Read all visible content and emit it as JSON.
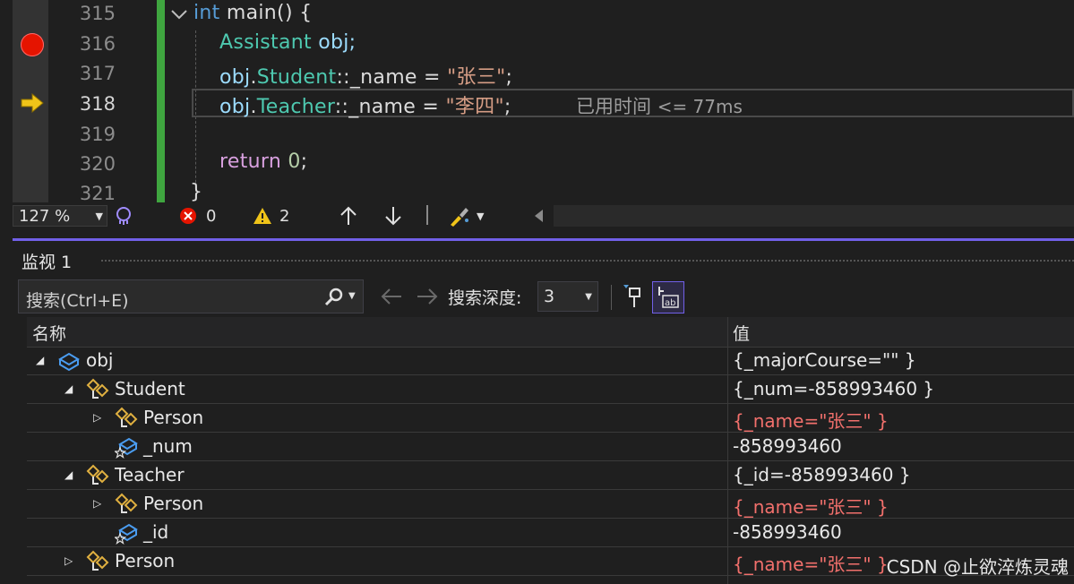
{
  "editor": {
    "lines": [
      {
        "num": "315",
        "current": false
      },
      {
        "num": "316",
        "current": false,
        "breakpoint": true
      },
      {
        "num": "317",
        "current": false
      },
      {
        "num": "318",
        "current": true,
        "exec": true
      },
      {
        "num": "319",
        "current": false
      },
      {
        "num": "320",
        "current": false
      },
      {
        "num": "321",
        "current": false
      }
    ],
    "code": {
      "l315_kw": "int",
      "l315_rest": " main() {",
      "l316_type": "Assistant",
      "l316_rest": " obj;",
      "l317_obj": "obj",
      "l317_dot": ".",
      "l317_base": "Student",
      "l317_member": "::_name = ",
      "l317_str": "\"张三\"",
      "l317_end": ";",
      "l318_obj": "obj",
      "l318_dot": ".",
      "l318_base": "Teacher",
      "l318_member": "::_name = ",
      "l318_str": "\"李四\"",
      "l318_end": ";",
      "l320_kw": "return",
      "l320_num": " 0",
      "l320_end": ";",
      "l321_brace": "}"
    },
    "perf_tip": {
      "label": "已用时间",
      "value": "<= 77ms"
    }
  },
  "status_bar": {
    "zoom": "127 %",
    "errors": "0",
    "warnings": "2"
  },
  "watch": {
    "title": "监视 1",
    "search_placeholder": "搜索(Ctrl+E)",
    "depth_label": "搜索深度:",
    "depth_value": "3",
    "col_name": "名称",
    "col_value": "值",
    "rows": [
      {
        "name": "obj",
        "value": "{_majorCourse=\"\" }",
        "changed": false
      },
      {
        "name": "Student",
        "value": "{_num=-858993460 }",
        "changed": false
      },
      {
        "name": "Person",
        "value": "{_name=\"张三\" }",
        "changed": true
      },
      {
        "name": "_num",
        "value": "-858993460",
        "changed": false
      },
      {
        "name": "Teacher",
        "value": "{_id=-858993460 }",
        "changed": false
      },
      {
        "name": "Person",
        "value": "{_name=\"张三\" }",
        "changed": true
      },
      {
        "name": "_id",
        "value": "-858993460",
        "changed": false
      },
      {
        "name": "Person",
        "value": "{_name=\"张三\" }",
        "changed": true
      }
    ],
    "watermark": "CSDN @止欲淬炼灵魂"
  },
  "colors": {
    "accent": "#7160e8",
    "breakpoint": "#e51400",
    "exec_arrow": "#f0c419",
    "changed_value": "#f2706c",
    "change_bar": "#3fa53f"
  },
  "icons": [
    "breakpoint-icon",
    "exec-arrow-icon",
    "intellicode-icon",
    "error-icon",
    "warning-icon",
    "arrow-up-icon",
    "arrow-down-icon",
    "brush-icon",
    "search-icon",
    "back-arrow-icon",
    "forward-arrow-icon",
    "pin-icon",
    "hex-display-icon",
    "object-icon",
    "base-class-icon",
    "field-icon"
  ]
}
